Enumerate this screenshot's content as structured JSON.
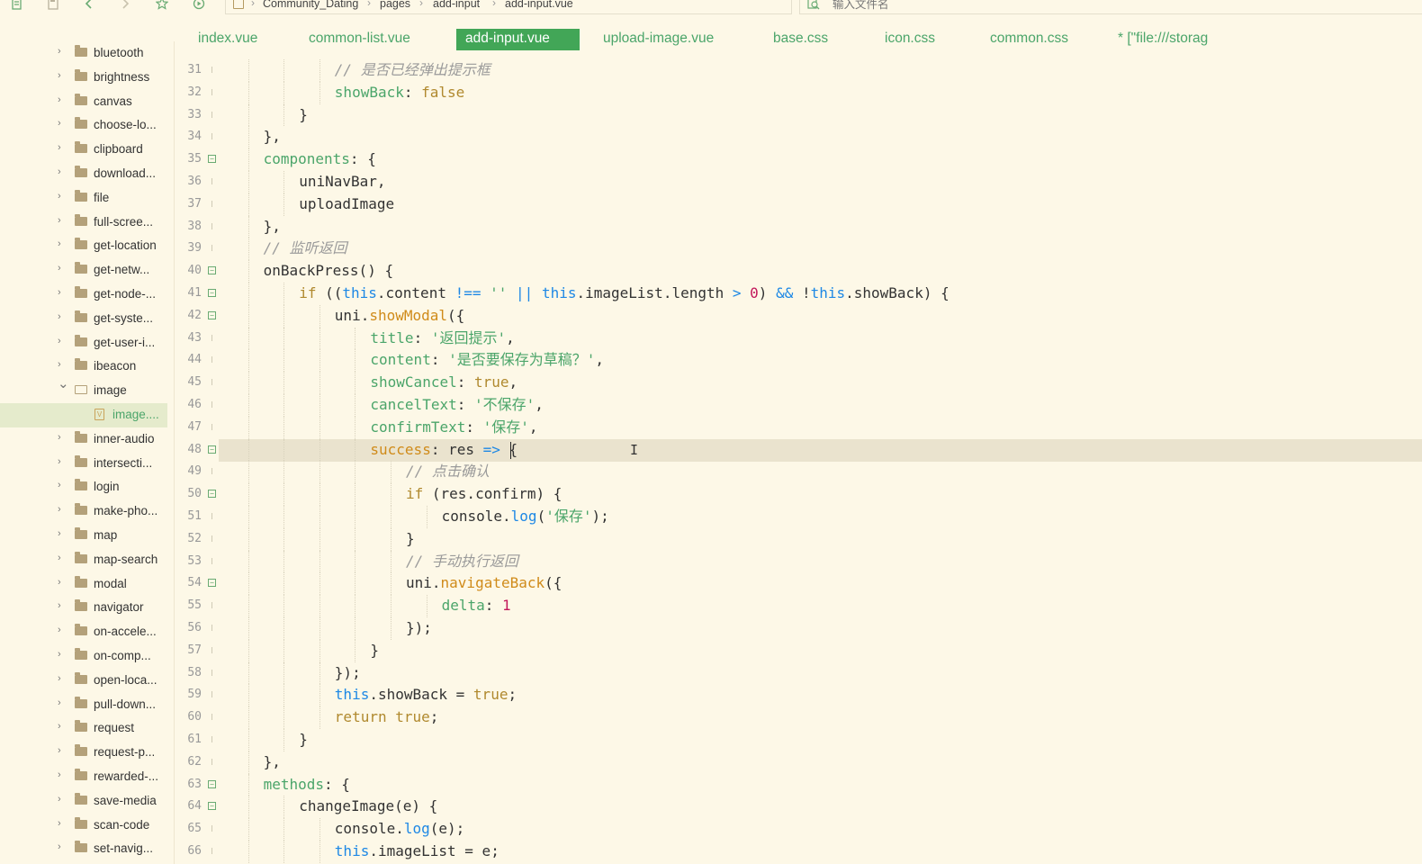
{
  "breadcrumb": [
    "Community_Dating",
    "pages",
    "add-input",
    "add-input.vue"
  ],
  "search": {
    "placeholder": "输入文件名"
  },
  "toolbar_icons": [
    "new-file-icon",
    "save-icon",
    "back-icon",
    "forward-icon",
    "star-icon",
    "run-icon"
  ],
  "tabs": [
    {
      "label": "index.vue",
      "active": false
    },
    {
      "label": "common-list.vue",
      "active": false
    },
    {
      "label": "add-input.vue",
      "active": true
    },
    {
      "label": "upload-image.vue",
      "active": false
    },
    {
      "label": "base.css",
      "active": false
    },
    {
      "label": "icon.css",
      "active": false
    },
    {
      "label": "common.css",
      "active": false
    },
    {
      "label": "* [\"file:///storag",
      "active": false
    }
  ],
  "sidebar": {
    "items": [
      {
        "label": "bluetooth",
        "type": "folder",
        "expanded": false
      },
      {
        "label": "brightness",
        "type": "folder",
        "expanded": false
      },
      {
        "label": "canvas",
        "type": "folder",
        "expanded": false
      },
      {
        "label": "choose-lo...",
        "type": "folder",
        "expanded": false
      },
      {
        "label": "clipboard",
        "type": "folder",
        "expanded": false
      },
      {
        "label": "download...",
        "type": "folder",
        "expanded": false
      },
      {
        "label": "file",
        "type": "folder",
        "expanded": false
      },
      {
        "label": "full-scree...",
        "type": "folder",
        "expanded": false
      },
      {
        "label": "get-location",
        "type": "folder",
        "expanded": false
      },
      {
        "label": "get-netw...",
        "type": "folder",
        "expanded": false
      },
      {
        "label": "get-node-...",
        "type": "folder",
        "expanded": false
      },
      {
        "label": "get-syste...",
        "type": "folder",
        "expanded": false
      },
      {
        "label": "get-user-i...",
        "type": "folder",
        "expanded": false
      },
      {
        "label": "ibeacon",
        "type": "folder",
        "expanded": false
      },
      {
        "label": "image",
        "type": "folder",
        "expanded": true
      },
      {
        "label": "image....",
        "type": "file",
        "selected": true
      },
      {
        "label": "inner-audio",
        "type": "folder",
        "expanded": false
      },
      {
        "label": "intersecti...",
        "type": "folder",
        "expanded": false
      },
      {
        "label": "login",
        "type": "folder",
        "expanded": false
      },
      {
        "label": "make-pho...",
        "type": "folder",
        "expanded": false
      },
      {
        "label": "map",
        "type": "folder",
        "expanded": false
      },
      {
        "label": "map-search",
        "type": "folder",
        "expanded": false
      },
      {
        "label": "modal",
        "type": "folder",
        "expanded": false
      },
      {
        "label": "navigator",
        "type": "folder",
        "expanded": false
      },
      {
        "label": "on-accele...",
        "type": "folder",
        "expanded": false
      },
      {
        "label": "on-comp...",
        "type": "folder",
        "expanded": false
      },
      {
        "label": "open-loca...",
        "type": "folder",
        "expanded": false
      },
      {
        "label": "pull-down...",
        "type": "folder",
        "expanded": false
      },
      {
        "label": "request",
        "type": "folder",
        "expanded": false
      },
      {
        "label": "request-p...",
        "type": "folder",
        "expanded": false
      },
      {
        "label": "rewarded-...",
        "type": "folder",
        "expanded": false
      },
      {
        "label": "save-media",
        "type": "folder",
        "expanded": false
      },
      {
        "label": "scan-code",
        "type": "folder",
        "expanded": false
      },
      {
        "label": "set-navig...",
        "type": "folder",
        "expanded": false
      }
    ]
  },
  "editor": {
    "current_line": 48,
    "lines": [
      {
        "n": 31,
        "fold": false,
        "indent": 4,
        "tokens": [
          [
            "c",
            "// 是否已经弹出提示框"
          ]
        ]
      },
      {
        "n": 32,
        "fold": false,
        "indent": 4,
        "tokens": [
          [
            "k",
            "showBack"
          ],
          [
            "t",
            ": "
          ],
          [
            "kw",
            "false"
          ]
        ]
      },
      {
        "n": 33,
        "fold": false,
        "indent": 3,
        "tokens": [
          [
            "t",
            "}"
          ]
        ]
      },
      {
        "n": 34,
        "fold": false,
        "indent": 2,
        "tokens": [
          [
            "t",
            "},"
          ]
        ]
      },
      {
        "n": 35,
        "fold": true,
        "indent": 2,
        "tokens": [
          [
            "k",
            "components"
          ],
          [
            "t",
            ": {"
          ]
        ]
      },
      {
        "n": 36,
        "fold": false,
        "indent": 3,
        "tokens": [
          [
            "t",
            "uniNavBar,"
          ]
        ]
      },
      {
        "n": 37,
        "fold": false,
        "indent": 3,
        "tokens": [
          [
            "t",
            "uploadImage"
          ]
        ]
      },
      {
        "n": 38,
        "fold": false,
        "indent": 2,
        "tokens": [
          [
            "t",
            "},"
          ]
        ]
      },
      {
        "n": 39,
        "fold": false,
        "indent": 2,
        "tokens": [
          [
            "c",
            "// 监听返回"
          ]
        ]
      },
      {
        "n": 40,
        "fold": true,
        "indent": 2,
        "tokens": [
          [
            "t",
            "onBackPress() {"
          ]
        ]
      },
      {
        "n": 41,
        "fold": true,
        "indent": 3,
        "tokens": [
          [
            "kw",
            "if"
          ],
          [
            "t",
            " (("
          ],
          [
            "b",
            "this"
          ],
          [
            "t",
            ".content "
          ],
          [
            "op",
            "!=="
          ],
          [
            "t",
            " "
          ],
          [
            "s",
            "''"
          ],
          [
            "t",
            " "
          ],
          [
            "op",
            "||"
          ],
          [
            "t",
            " "
          ],
          [
            "b",
            "this"
          ],
          [
            "t",
            ".imageList.length "
          ],
          [
            "op",
            ">"
          ],
          [
            "t",
            " "
          ],
          [
            "n",
            "0"
          ],
          [
            "t",
            ") "
          ],
          [
            "op",
            "&&"
          ],
          [
            "t",
            " !"
          ],
          [
            "b",
            "this"
          ],
          [
            "t",
            ".showBack) {"
          ]
        ]
      },
      {
        "n": 42,
        "fold": true,
        "indent": 4,
        "tokens": [
          [
            "t",
            "uni."
          ],
          [
            "fn",
            "showModal"
          ],
          [
            "t",
            "({"
          ]
        ]
      },
      {
        "n": 43,
        "fold": false,
        "indent": 5,
        "tokens": [
          [
            "k",
            "title"
          ],
          [
            "t",
            ": "
          ],
          [
            "s",
            "'返回提示'"
          ],
          [
            "t",
            ","
          ]
        ]
      },
      {
        "n": 44,
        "fold": false,
        "indent": 5,
        "tokens": [
          [
            "k",
            "content"
          ],
          [
            "t",
            ": "
          ],
          [
            "s",
            "'是否要保存为草稿？'"
          ],
          [
            "t",
            ","
          ]
        ]
      },
      {
        "n": 45,
        "fold": false,
        "indent": 5,
        "tokens": [
          [
            "k",
            "showCancel"
          ],
          [
            "t",
            ": "
          ],
          [
            "kw",
            "true"
          ],
          [
            "t",
            ","
          ]
        ]
      },
      {
        "n": 46,
        "fold": false,
        "indent": 5,
        "tokens": [
          [
            "k",
            "cancelText"
          ],
          [
            "t",
            ": "
          ],
          [
            "s",
            "'不保存'"
          ],
          [
            "t",
            ","
          ]
        ]
      },
      {
        "n": 47,
        "fold": false,
        "indent": 5,
        "tokens": [
          [
            "k",
            "confirmText"
          ],
          [
            "t",
            ": "
          ],
          [
            "s",
            "'保存'"
          ],
          [
            "t",
            ","
          ]
        ]
      },
      {
        "n": 48,
        "fold": true,
        "indent": 5,
        "tokens": [
          [
            "fn",
            "success"
          ],
          [
            "t",
            ": res "
          ],
          [
            "op",
            "=>"
          ],
          [
            "t",
            " {"
          ]
        ]
      },
      {
        "n": 49,
        "fold": false,
        "indent": 6,
        "tokens": [
          [
            "c",
            "// 点击确认"
          ]
        ]
      },
      {
        "n": 50,
        "fold": true,
        "indent": 6,
        "tokens": [
          [
            "kw",
            "if"
          ],
          [
            "t",
            " (res.confirm) {"
          ]
        ]
      },
      {
        "n": 51,
        "fold": false,
        "indent": 7,
        "tokens": [
          [
            "t",
            "console."
          ],
          [
            "b",
            "log"
          ],
          [
            "t",
            "("
          ],
          [
            "s",
            "'保存'"
          ],
          [
            "t",
            ");"
          ]
        ]
      },
      {
        "n": 52,
        "fold": false,
        "indent": 6,
        "tokens": [
          [
            "t",
            "}"
          ]
        ]
      },
      {
        "n": 53,
        "fold": false,
        "indent": 6,
        "tokens": [
          [
            "c",
            "// 手动执行返回"
          ]
        ]
      },
      {
        "n": 54,
        "fold": true,
        "indent": 6,
        "tokens": [
          [
            "t",
            "uni."
          ],
          [
            "fn",
            "navigateBack"
          ],
          [
            "t",
            "({"
          ]
        ]
      },
      {
        "n": 55,
        "fold": false,
        "indent": 7,
        "tokens": [
          [
            "k",
            "delta"
          ],
          [
            "t",
            ": "
          ],
          [
            "n",
            "1"
          ]
        ]
      },
      {
        "n": 56,
        "fold": false,
        "indent": 6,
        "tokens": [
          [
            "t",
            "});"
          ]
        ]
      },
      {
        "n": 57,
        "fold": false,
        "indent": 5,
        "tokens": [
          [
            "t",
            "}"
          ]
        ]
      },
      {
        "n": 58,
        "fold": false,
        "indent": 4,
        "tokens": [
          [
            "t",
            "});"
          ]
        ]
      },
      {
        "n": 59,
        "fold": false,
        "indent": 4,
        "tokens": [
          [
            "b",
            "this"
          ],
          [
            "t",
            ".showBack = "
          ],
          [
            "kw",
            "true"
          ],
          [
            "t",
            ";"
          ]
        ]
      },
      {
        "n": 60,
        "fold": false,
        "indent": 4,
        "tokens": [
          [
            "kw",
            "return"
          ],
          [
            "t",
            " "
          ],
          [
            "kw",
            "true"
          ],
          [
            "t",
            ";"
          ]
        ]
      },
      {
        "n": 61,
        "fold": false,
        "indent": 3,
        "tokens": [
          [
            "t",
            "}"
          ]
        ]
      },
      {
        "n": 62,
        "fold": false,
        "indent": 2,
        "tokens": [
          [
            "t",
            "},"
          ]
        ]
      },
      {
        "n": 63,
        "fold": true,
        "indent": 2,
        "tokens": [
          [
            "k",
            "methods"
          ],
          [
            "t",
            ": {"
          ]
        ]
      },
      {
        "n": 64,
        "fold": true,
        "indent": 3,
        "tokens": [
          [
            "t",
            "changeImage(e) {"
          ]
        ]
      },
      {
        "n": 65,
        "fold": false,
        "indent": 4,
        "tokens": [
          [
            "t",
            "console."
          ],
          [
            "b",
            "log"
          ],
          [
            "t",
            "(e);"
          ]
        ]
      },
      {
        "n": 66,
        "fold": false,
        "indent": 4,
        "tokens": [
          [
            "b",
            "this"
          ],
          [
            "t",
            ".imageList = e;"
          ]
        ]
      }
    ]
  }
}
